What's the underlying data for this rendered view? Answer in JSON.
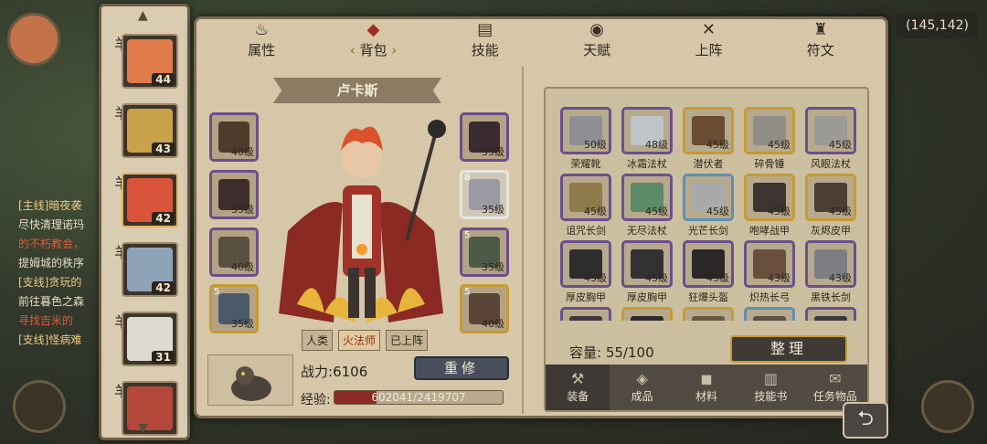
{
  "world": {
    "coord": "(145,142)",
    "quests": [
      {
        "title": "[主线]暗夜袭",
        "line1": "尽快清理诺玛",
        "line2": "的不朽教会，",
        "line3": "提姆城的秩序"
      },
      {
        "title": "[支线]贪玩的",
        "line1": "前往暮色之森",
        "line2": "寻找吉米的",
        "line3": ""
      },
      {
        "title": "[支线]怪病难",
        "line1": "",
        "line2": "",
        "line3": ""
      }
    ]
  },
  "heroes": [
    {
      "level": "44",
      "badge": "羊",
      "color": "#e07b4a"
    },
    {
      "level": "43",
      "badge": "羊",
      "color": "#c9a24a"
    },
    {
      "level": "42",
      "badge": "羊",
      "color": "#d9543a"
    },
    {
      "level": "42",
      "badge": "羊",
      "color": "#8fa3b8"
    },
    {
      "level": "31",
      "badge": "羊",
      "color": "#dedad0"
    },
    {
      "level": "",
      "badge": "羊",
      "color": "#b5483a"
    }
  ],
  "tabs": [
    {
      "label": "属性",
      "icon": "♨"
    },
    {
      "label": "背包",
      "icon": "◆"
    },
    {
      "label": "技能",
      "icon": "▤"
    },
    {
      "label": "天赋",
      "icon": "◉"
    },
    {
      "label": "上阵",
      "icon": "✕"
    },
    {
      "label": "符文",
      "icon": "♜"
    }
  ],
  "hero": {
    "name": "卢卡斯",
    "tags": [
      "人类",
      "火法师",
      "已上阵"
    ],
    "power_label": "战力:",
    "power": "6106",
    "rebuild_label": "重修",
    "exp_label": "经验:",
    "exp_text": "602041/2419707",
    "exp_fraction": 0.249
  },
  "equipped": [
    {
      "level": "40级",
      "color": "#4e3b2c",
      "star": ""
    },
    {
      "level": "35级",
      "color": "#3d2e2b",
      "star": ""
    },
    {
      "level": "40级",
      "color": "#5a5040",
      "star": ""
    },
    {
      "level": "35级",
      "color": "#4a5a6b",
      "star": "5"
    },
    {
      "level": "35级",
      "color": "#3a2b30",
      "star": ""
    },
    {
      "level": "35级",
      "color": "#9a9aa4",
      "star": "8"
    },
    {
      "level": "35级",
      "color": "#4e5a48",
      "star": "5"
    },
    {
      "level": "40级",
      "color": "#5a4438",
      "star": "5"
    }
  ],
  "inventory": {
    "items": [
      {
        "name": "荣耀靴",
        "level": "50级",
        "color": "#8c8e92",
        "tier": "purple"
      },
      {
        "name": "冰霜法杖",
        "level": "48级",
        "color": "#bfc4c8",
        "tier": "purple"
      },
      {
        "name": "潜伏者",
        "level": "45级",
        "color": "#6b4d33",
        "tier": "gold"
      },
      {
        "name": "碎骨锤",
        "level": "45级",
        "color": "#8f8d86",
        "tier": "gold"
      },
      {
        "name": "风眼法杖",
        "level": "45级",
        "color": "#9b9a94",
        "tier": "purple"
      },
      {
        "name": "诅咒长剑",
        "level": "45级",
        "color": "#8f7a4c",
        "tier": "purple"
      },
      {
        "name": "无尽法杖",
        "level": "45级",
        "color": "#5c8b68",
        "tier": "purple"
      },
      {
        "name": "光芒长剑",
        "level": "45级",
        "color": "#a8a9aa",
        "tier": "blue"
      },
      {
        "name": "咆哮战甲",
        "level": "45级",
        "color": "#3d3530",
        "tier": "gold"
      },
      {
        "name": "灰烬皮甲",
        "level": "45级",
        "color": "#4a3e35",
        "tier": "gold"
      },
      {
        "name": "厚皮胸甲",
        "level": "45级",
        "color": "#2e2c2d",
        "tier": "purple"
      },
      {
        "name": "厚皮胸甲",
        "level": "45级",
        "color": "#333132",
        "tier": "purple"
      },
      {
        "name": "狂爆头盔",
        "level": "45级",
        "color": "#2b2729",
        "tier": "purple"
      },
      {
        "name": "炽热长弓",
        "level": "43级",
        "color": "#6b4f3e",
        "tier": "purple"
      },
      {
        "name": "黑铁长剑",
        "level": "43级",
        "color": "#7d7e82",
        "tier": "purple"
      },
      {
        "name": "",
        "level": "",
        "color": "#3e3a40",
        "tier": "purple"
      },
      {
        "name": "",
        "level": "",
        "color": "#2e2b2a",
        "tier": "gold"
      },
      {
        "name": "",
        "level": "",
        "color": "#6b5744",
        "tier": "gold"
      },
      {
        "name": "",
        "level": "",
        "color": "#5e5048",
        "tier": "blue"
      },
      {
        "name": "",
        "level": "",
        "color": "#3d3a3e",
        "tier": "purple"
      }
    ],
    "capacity_label": "容量:",
    "capacity": "55/100",
    "sort_label": "整理",
    "tabs": [
      {
        "label": "装备",
        "icon": "⚒"
      },
      {
        "label": "成品",
        "icon": "◈"
      },
      {
        "label": "材料",
        "icon": "◼"
      },
      {
        "label": "技能书",
        "icon": "▥"
      },
      {
        "label": "任务物品",
        "icon": "✉"
      }
    ]
  },
  "colors": {
    "panel": "#d6c7a8",
    "accent_red": "#a02d24",
    "purple_tier": "#6b4f8c",
    "gold_tier": "#c59a35",
    "blue_tier": "#5d8fb4"
  }
}
